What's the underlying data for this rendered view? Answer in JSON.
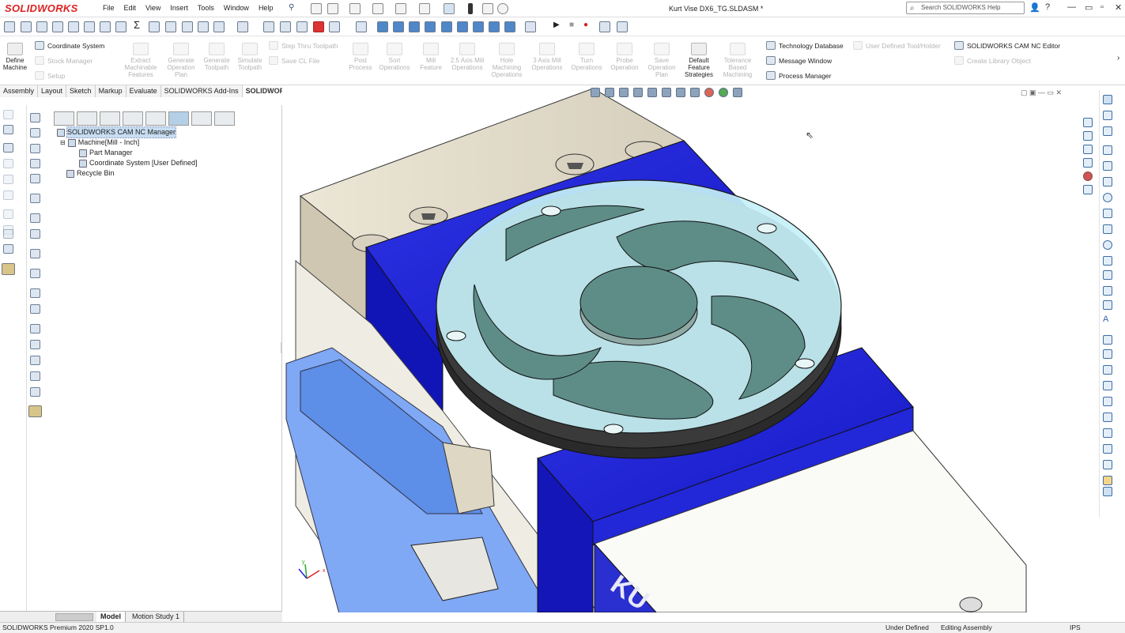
{
  "app": {
    "logo": "SOLIDWORKS",
    "document_title": "Kurt Vise DX6_TG.SLDASM *"
  },
  "menu": [
    "File",
    "Edit",
    "View",
    "Insert",
    "Tools",
    "Window",
    "Help"
  ],
  "search": {
    "placeholder": "Search SOLIDWORKS Help"
  },
  "ribbon": {
    "define_machine": "Define Machine",
    "coordinate_system": "Coordinate System",
    "stock_manager": "Stock Manager",
    "setup": "Setup",
    "extract": "Extract Machinable Features",
    "gen_op_plan": "Generate Operation Plan",
    "gen_toolpath": "Generate Toolpath",
    "simulate": "Simulate Toolpath",
    "step_thru": "Step Thru Toolpath",
    "save_cl": "Save CL File",
    "post": "Post Process",
    "sort": "Sort Operations",
    "mill_feature": "Mill Feature",
    "mill_25": "2.5 Axis Mill Operations",
    "hole_ops": "Hole Machining Operations",
    "mill_3": "3 Axis Mill Operations",
    "turn": "Turn Operations",
    "probe": "Probe Operation",
    "save_plan": "Save Operation Plan",
    "default_strategies": "Default Feature Strategies",
    "tolerance": "Tolerance Based Machining",
    "tech_db": "Technology Database",
    "message_window": "Message Window",
    "process_manager": "Process Manager",
    "user_tool": "User Defined Tool/Holder",
    "nc_editor": "SOLIDWORKS CAM NC Editor",
    "create_library": "Create Library Object"
  },
  "tabs": [
    "Assembly",
    "Layout",
    "Sketch",
    "Markup",
    "Evaluate",
    "SOLIDWORKS Add-Ins",
    "SOLIDWORKS CAM"
  ],
  "tree": {
    "root": "SOLIDWORKS CAM NC Manager",
    "machine": "Machine[Mill - Inch]",
    "part_manager": "Part Manager",
    "coord_system": "Coordinate System [User Defined]",
    "recycle": "Recycle Bin"
  },
  "triad": {
    "x": "x",
    "y": "y"
  },
  "bottom_tabs": [
    "Model",
    "Motion Study 1"
  ],
  "status": {
    "left": "SOLIDWORKS Premium 2020 SP1.0",
    "definition": "Under Defined",
    "mode": "Editing Assembly",
    "units": "IPS"
  },
  "colors": {
    "brand": "#d22222",
    "vise_blue": "#1b1fd4",
    "fixture_light": "#e8e3d4",
    "plate": "#bfeef5",
    "pocket": "#5e8d88"
  }
}
